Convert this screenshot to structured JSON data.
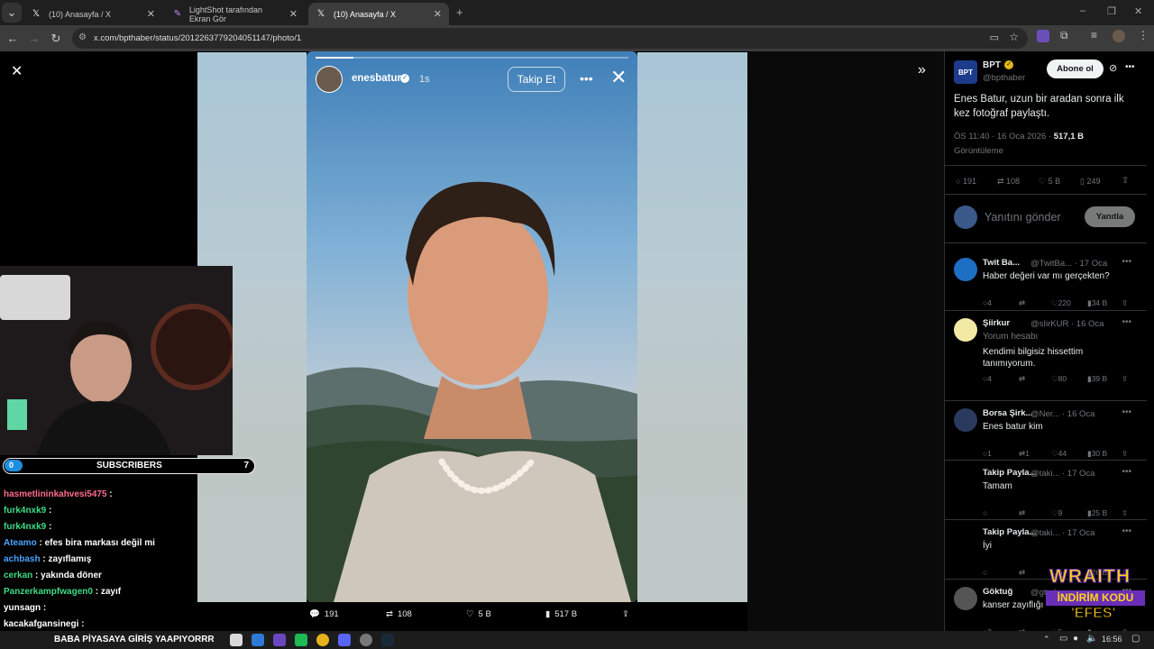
{
  "tabs": [
    {
      "title": "(10) Anasayfa / X",
      "icon": "x-logo-icon"
    },
    {
      "title": "LightShot tarafından Ekran Gör",
      "icon": "lightshot-icon"
    },
    {
      "title": "(10) Anasayfa / X",
      "icon": "x-logo-icon"
    }
  ],
  "address": {
    "url": "x.com/bpthaber/status/2012263779204051147/photo/1"
  },
  "story": {
    "username": "enesbatur",
    "time": "1s",
    "follow_label": "Takip Et"
  },
  "bottom_actions": {
    "replies": "191",
    "reposts": "108",
    "likes": "5 B",
    "views": "517 B"
  },
  "post": {
    "author_name": "BPT",
    "author_handle": "@bpthaber",
    "subscribe_label": "Abone ol",
    "text": "Enes Batur, uzun bir aradan sonra ilk kez fotoğraf paylaştı.",
    "timestamp": "ÖS 11:40 · 16 Oca 2026 ·",
    "views_count": "517,1 B",
    "views_label": "Görüntüleme",
    "stats": {
      "replies": "191",
      "reposts": "108",
      "likes": "5 B",
      "bookmarks": "249"
    },
    "reply_placeholder": "Yanıtını gönder",
    "reply_button": "Yanıtla"
  },
  "replies": [
    {
      "name": "Twit Ba...",
      "handle": "@TwitBa... · 17 Oca",
      "text": "Haber değeri var mı gerçekten?",
      "sub": "",
      "r": "4",
      "rt": "",
      "l": "220",
      "v": "34 B",
      "avatar": "#1d6fc4"
    },
    {
      "name": "Şiirkur",
      "handle": "@sIirKUR · 16 Oca",
      "text": "Kendimi bilgisiz hissettim tanımıyorum.",
      "sub": "Yorum hesabı",
      "r": "4",
      "rt": "",
      "l": "80",
      "v": "39 B",
      "avatar": "#f2e9a5"
    },
    {
      "name": "Borsa Şirk...",
      "handle": "@Ner... · 16 Oca",
      "text": "Enes batur kim",
      "sub": "",
      "r": "1",
      "rt": "1",
      "l": "44",
      "v": "30 B",
      "avatar": "#2a3a5e"
    },
    {
      "name": "Takip Payla...",
      "handle": "@taki... · 17 Oca",
      "text": "Tamam",
      "sub": "",
      "r": "",
      "rt": "",
      "l": "9",
      "v": "25 B",
      "avatar": "#000"
    },
    {
      "name": "Takip Payla...",
      "handle": "@taki... · 17 Oca",
      "text": "İyi",
      "sub": "",
      "r": "",
      "rt": "",
      "l": "6",
      "v": "26 B",
      "avatar": "#000"
    },
    {
      "name": "Göktuğ",
      "handle": "@gturha...",
      "text": "kanser zayıflığı",
      "sub": "",
      "r": "2",
      "rt": "",
      "l": "5",
      "v": "",
      "avatar": "#555"
    }
  ],
  "stream": {
    "subs_count_left": "0",
    "subs_label": "SUBSCRIBERS",
    "subs_count_right": "7",
    "chat": [
      {
        "user": "hasmetlininkahvesi5475",
        "color": "#ff6b8b",
        "msg": ""
      },
      {
        "user": "furk4nxk9",
        "color": "#3ddc84",
        "msg": ""
      },
      {
        "user": "furk4nxk9",
        "color": "#3ddc84",
        "msg": ""
      },
      {
        "user": "Ateamo",
        "color": "#4aa3ff",
        "msg": "efes bira markası değil mi"
      },
      {
        "user": "achbash",
        "color": "#4aa3ff",
        "msg": "zayıflamış"
      },
      {
        "user": "cerkan",
        "color": "#3ddc84",
        "msg": "yakında döner"
      },
      {
        "user": "Panzerkampfwagen0",
        "color": "#3ddc84",
        "msg": "zayıf"
      },
      {
        "user": "yunsagn",
        "color": "#ffffff",
        "msg": ""
      },
      {
        "user": "kacakafgansinegi",
        "color": "#ffffff",
        "msg": ""
      }
    ],
    "ticker": "BABA PİYASAYA GİRİŞ YAAPIYORRR"
  },
  "promo": {
    "line1": "WRAITH",
    "line2": "İNDİRİM KODU",
    "line3": "'EFES'"
  },
  "clock": "16:56",
  "colors": {
    "accent": "#1d9bf0",
    "promo_purple": "#6a2fb8",
    "promo_yellow": "#ffd21a"
  }
}
